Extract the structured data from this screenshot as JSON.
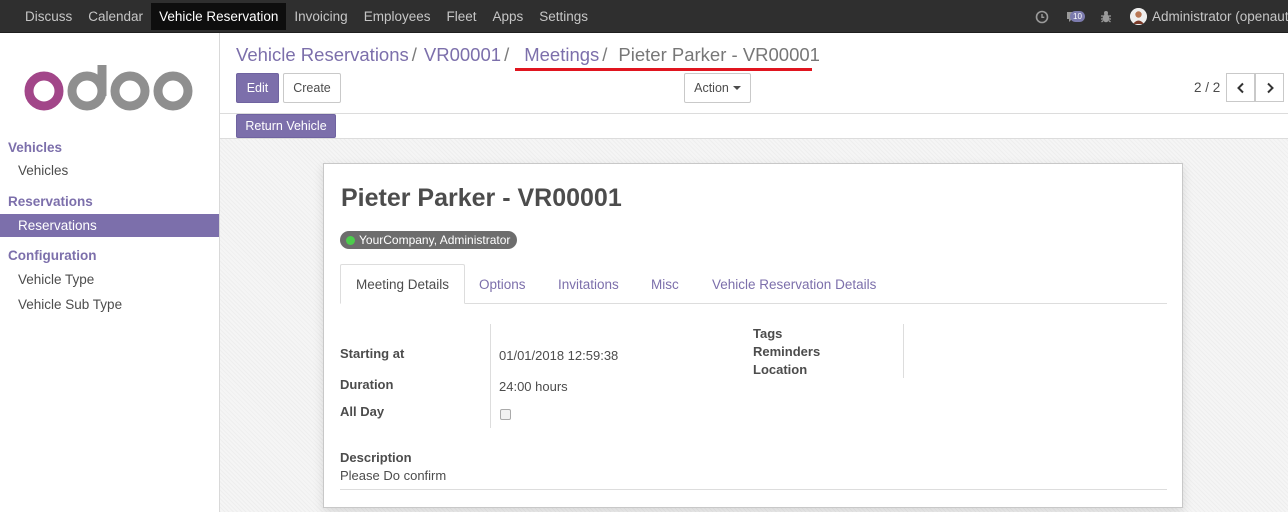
{
  "topbar": {
    "menu": [
      "Discuss",
      "Calendar",
      "Vehicle Reservation",
      "Invoicing",
      "Employees",
      "Fleet",
      "Apps",
      "Settings"
    ],
    "active_menu": "Vehicle Reservation",
    "message_count": "10",
    "user": "Administrator (openaut…"
  },
  "sidebar": {
    "logo_text": "odoo",
    "sections": [
      {
        "title": "Vehicles",
        "items": [
          "Vehicles"
        ]
      },
      {
        "title": "Reservations",
        "items": [
          "Reservations"
        ]
      },
      {
        "title": "Configuration",
        "items": [
          "Vehicle Type",
          "Vehicle Sub Type"
        ]
      }
    ],
    "active_item": "Reservations"
  },
  "breadcrumb": [
    "Vehicle Reservations",
    "VR00001",
    "Meetings",
    "Pieter Parker - VR00001"
  ],
  "buttons": {
    "edit": "Edit",
    "create": "Create",
    "action": "Action",
    "return_vehicle": "Return Vehicle"
  },
  "pager": "2 / 2",
  "record": {
    "title": "Pieter Parker - VR00001",
    "attendee_tag": "YourCompany, Administrator",
    "tabs": [
      "Meeting Details",
      "Options",
      "Invitations",
      "Misc",
      "Vehicle Reservation Details"
    ],
    "active_tab": "Meeting Details",
    "fields": {
      "starting_at_label": "Starting at",
      "starting_at": "01/01/2018 12:59:38",
      "duration_label": "Duration",
      "duration": "24:00 hours",
      "all_day_label": "All Day",
      "all_day": false,
      "tags_label": "Tags",
      "reminders_label": "Reminders",
      "location_label": "Location",
      "description_label": "Description",
      "description": "Please Do confirm"
    }
  },
  "colors": {
    "brand": "#7c6fab",
    "navbar": "#2f2f2f",
    "annotation_underline": "#e0151f"
  }
}
